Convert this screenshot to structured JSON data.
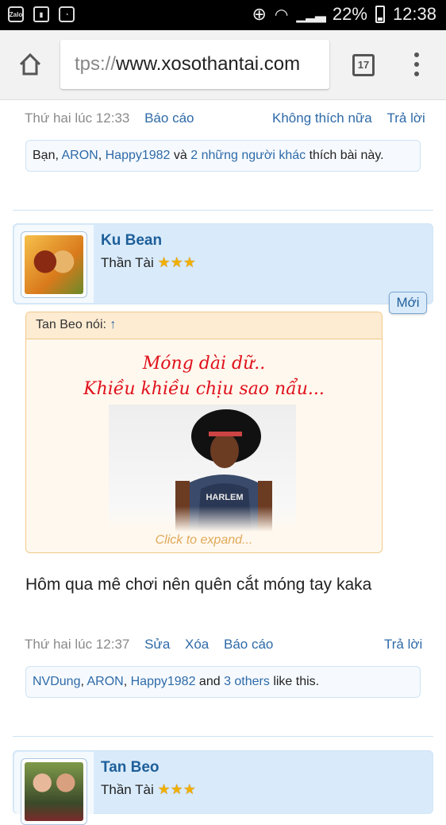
{
  "status": {
    "battery": "22%",
    "time": "12:38"
  },
  "browser": {
    "url_prefix": "tps://",
    "url_main": "www.xosothantai.com",
    "tab_count": "17"
  },
  "post1": {
    "time": "Thứ hai lúc 12:33",
    "report": "Báo cáo",
    "unlike": "Không thích nữa",
    "reply": "Trả lời",
    "likes": {
      "t1": "Bạn, ",
      "u1": "ARON",
      "t2": ", ",
      "u2": "Happy1982",
      "t3": " và ",
      "u3": "2 những người khác",
      "t4": " thích bài này."
    }
  },
  "post2": {
    "username": "Ku Bean",
    "title": "Thần Tài",
    "stars": "★★★",
    "new_badge": "Mới",
    "quote": {
      "author": "Tan Beo nói: ",
      "arrow": "↑",
      "line1": "Móng dài dữ..",
      "line2": "Khiều khiều chịu sao nẩu...",
      "image_text": "HARLEM",
      "expand": "Click to expand..."
    },
    "body": "Hôm qua mê chơi nên quên cắt móng tay kaka",
    "time": "Thứ hai lúc 12:37",
    "edit": "Sửa",
    "delete": "Xóa",
    "report": "Báo cáo",
    "reply": "Trả lời",
    "likes": {
      "u1": "NVDung",
      "t1": ", ",
      "u2": "ARON",
      "t2": ", ",
      "u3": "Happy1982",
      "t3": " and ",
      "u4": "3 others",
      "t4": " like this."
    }
  },
  "post3": {
    "username": "Tan Beo",
    "title": "Thần Tài",
    "stars": "★★★"
  }
}
